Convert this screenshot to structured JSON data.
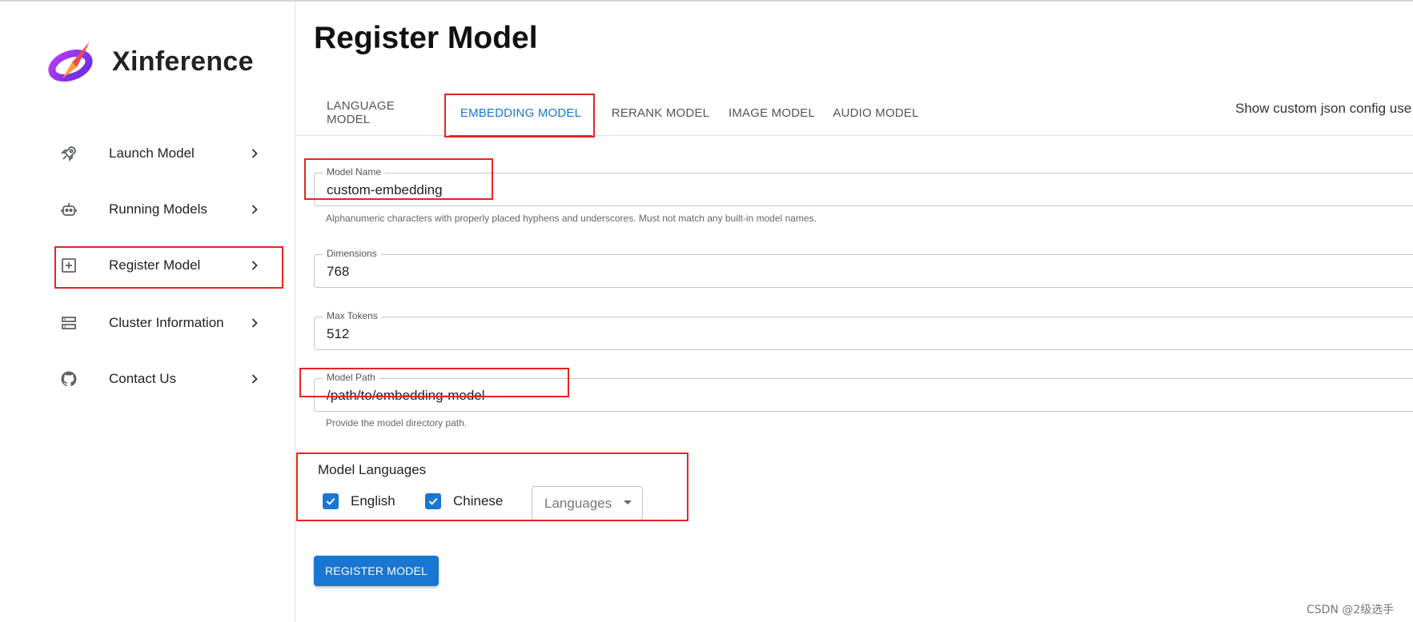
{
  "app": {
    "name": "Xinference"
  },
  "sidebar": {
    "items": [
      {
        "label": "Launch Model",
        "icon": "rocket-icon"
      },
      {
        "label": "Running Models",
        "icon": "robot-icon"
      },
      {
        "label": "Register Model",
        "icon": "add-box-icon"
      },
      {
        "label": "Cluster Information",
        "icon": "storage-icon"
      },
      {
        "label": "Contact Us",
        "icon": "github-icon"
      }
    ]
  },
  "main": {
    "title": "Register Model",
    "tabs": [
      {
        "label": "LANGUAGE MODEL",
        "active": false
      },
      {
        "label": "EMBEDDING MODEL",
        "active": true
      },
      {
        "label": "RERANK MODEL",
        "active": false
      },
      {
        "label": "IMAGE MODEL",
        "active": false
      },
      {
        "label": "AUDIO MODEL",
        "active": false
      }
    ],
    "json_toggle_label": "Show custom json config use",
    "form": {
      "model_name": {
        "label": "Model Name",
        "value": "custom-embedding",
        "helper": "Alphanumeric characters with properly placed hyphens and underscores. Must not match any built-in model names."
      },
      "dimensions": {
        "label": "Dimensions",
        "value": "768"
      },
      "max_tokens": {
        "label": "Max Tokens",
        "value": "512"
      },
      "model_path": {
        "label": "Model Path",
        "value": "/path/to/embedding-model",
        "helper": "Provide the model directory path."
      },
      "languages": {
        "title": "Model Languages",
        "options": [
          {
            "label": "English",
            "checked": true
          },
          {
            "label": "Chinese",
            "checked": true
          }
        ],
        "select_placeholder": "Languages"
      },
      "submit_label": "REGISTER MODEL"
    }
  },
  "watermark": "CSDN @2级选手",
  "colors": {
    "accent": "#1976d2",
    "annotation": "#e8231f"
  }
}
